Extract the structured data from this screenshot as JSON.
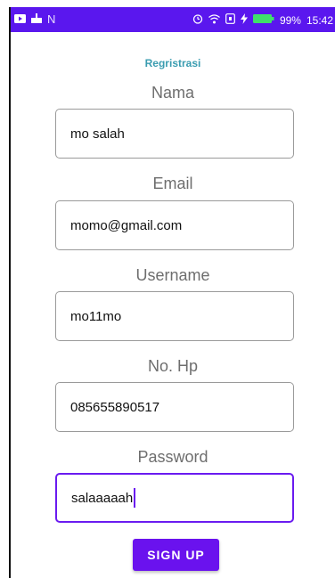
{
  "status_bar": {
    "battery": "99%",
    "time": "15:42",
    "carrier_glyph": "N",
    "bg_color": "#5a17ee"
  },
  "app": {
    "title": "Regristrasi"
  },
  "form": {
    "nama": {
      "label": "Nama",
      "value": "mo salah"
    },
    "email": {
      "label": "Email",
      "value": "momo@gmail.com"
    },
    "username": {
      "label": "Username",
      "value": "mo11mo"
    },
    "hp": {
      "label": "No. Hp",
      "value": "085655890517"
    },
    "password": {
      "label": "Password",
      "value": "salaaaaah"
    }
  },
  "signup": {
    "label": "SIGN UP",
    "color": "#6a12ee"
  },
  "accent": "#6a1bf0"
}
